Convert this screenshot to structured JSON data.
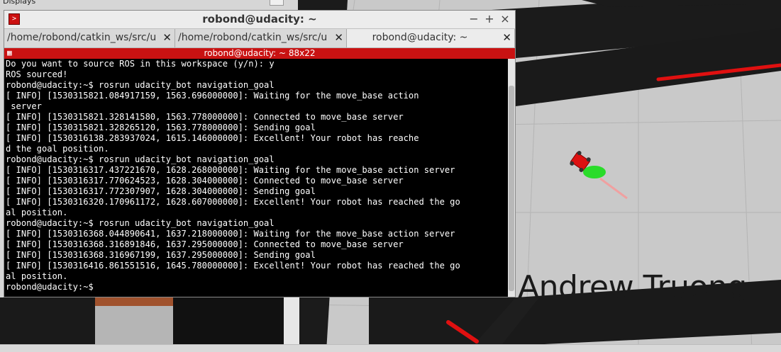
{
  "background": {
    "displays_label": "Displays",
    "overlay_name": "Andrew Truong"
  },
  "window": {
    "title": "robond@udacity: ~",
    "minimize_label": "−",
    "maximize_label": "+",
    "close_label": "×"
  },
  "tabs": [
    {
      "label": "/home/robond/catkin_ws/src/u",
      "close": "✕"
    },
    {
      "label": "/home/robond/catkin_ws/src/u",
      "close": "✕"
    },
    {
      "label": "robond@udacity: ~",
      "close": "✕"
    }
  ],
  "terminal": {
    "subtitle": "robond@udacity: ~ 88x22",
    "lines": [
      "Do you want to source ROS in this workspace (y/n): y",
      "ROS sourced!",
      "robond@udacity:~$ rosrun udacity_bot navigation_goal",
      "[ INFO] [1530315821.084917159, 1563.696000000]: Waiting for the move_base action",
      " server",
      "[ INFO] [1530315821.328141580, 1563.778000000]: Connected to move_base server",
      "[ INFO] [1530315821.328265120, 1563.778000000]: Sending goal",
      "[ INFO] [1530316138.283937024, 1615.146000000]: Excellent! Your robot has reache",
      "d the goal position.",
      "robond@udacity:~$ rosrun udacity_bot navigation_goal",
      "[ INFO] [1530316317.437221670, 1628.268000000]: Waiting for the move_base action server",
      "[ INFO] [1530316317.770624523, 1628.304000000]: Connected to move_base server",
      "[ INFO] [1530316317.772307907, 1628.304000000]: Sending goal",
      "[ INFO] [1530316320.170961172, 1628.607000000]: Excellent! Your robot has reached the go",
      "al position.",
      "robond@udacity:~$ rosrun udacity_bot navigation_goal",
      "[ INFO] [1530316368.044890641, 1637.218000000]: Waiting for the move_base action server",
      "[ INFO] [1530316368.316891846, 1637.295000000]: Connected to move_base server",
      "[ INFO] [1530316368.316967199, 1637.295000000]: Sending goal",
      "[ INFO] [1530316416.861551516, 1645.780000000]: Excellent! Your robot has reached the go",
      "al position.",
      "robond@udacity:~$ "
    ]
  },
  "colors": {
    "terminal_bg": "#000000",
    "terminal_fg": "#ffffff",
    "subbar_red": "#c91212",
    "path_red": "#e01010",
    "robot_green": "#22dd22"
  }
}
